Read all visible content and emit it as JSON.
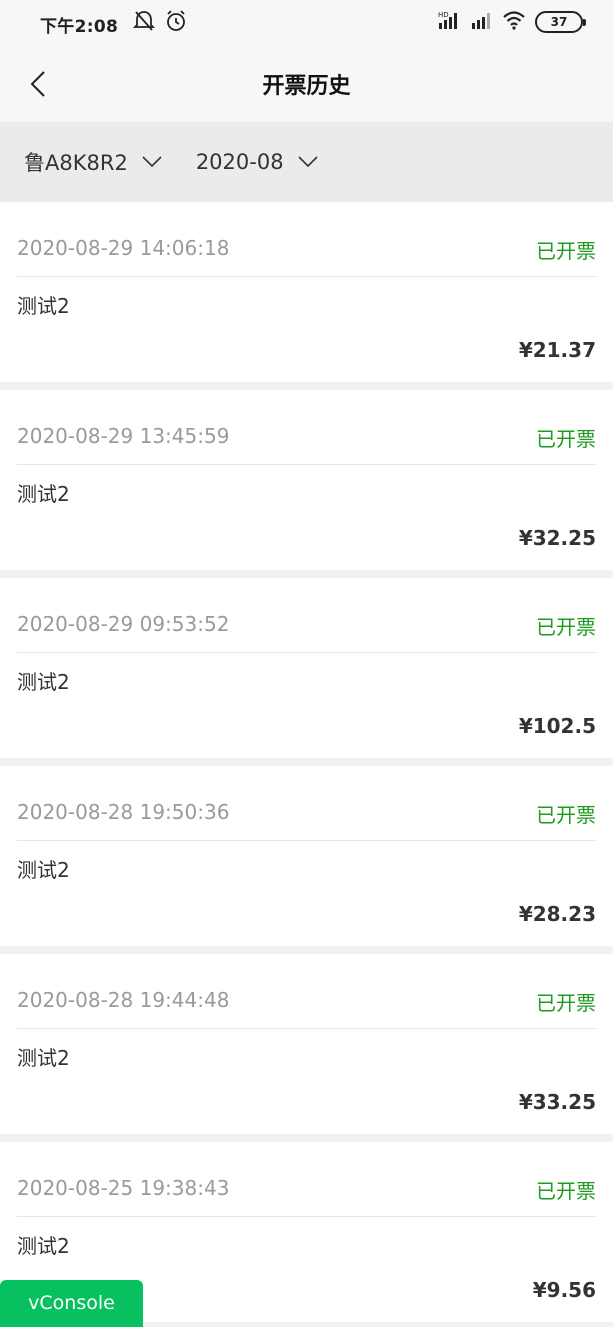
{
  "status_bar": {
    "time": "下午2:08",
    "battery": "37",
    "icons": [
      "notification-muted-icon",
      "alarm-icon",
      "hd-signal-icon",
      "signal-icon",
      "wifi-icon",
      "battery-icon"
    ]
  },
  "header": {
    "title": "开票历史"
  },
  "filters": {
    "plate": "鲁A8K8R2",
    "month": "2020-08"
  },
  "records": [
    {
      "time": "2020-08-29 14:06:18",
      "status": "已开票",
      "name": "测试2",
      "amount": "¥21.37"
    },
    {
      "time": "2020-08-29 13:45:59",
      "status": "已开票",
      "name": "测试2",
      "amount": "¥32.25"
    },
    {
      "time": "2020-08-29 09:53:52",
      "status": "已开票",
      "name": "测试2",
      "amount": "¥102.5"
    },
    {
      "time": "2020-08-28 19:50:36",
      "status": "已开票",
      "name": "测试2",
      "amount": "¥28.23"
    },
    {
      "time": "2020-08-28 19:44:48",
      "status": "已开票",
      "name": "测试2",
      "amount": "¥33.25"
    },
    {
      "time": "2020-08-25 19:38:43",
      "status": "已开票",
      "name": "测试2",
      "amount": "¥9.56"
    }
  ],
  "vconsole": {
    "label": "vConsole"
  },
  "colors": {
    "status_green": "#1f9b1f",
    "vconsole_green": "#07c160",
    "filter_background": "#ebebeb"
  }
}
